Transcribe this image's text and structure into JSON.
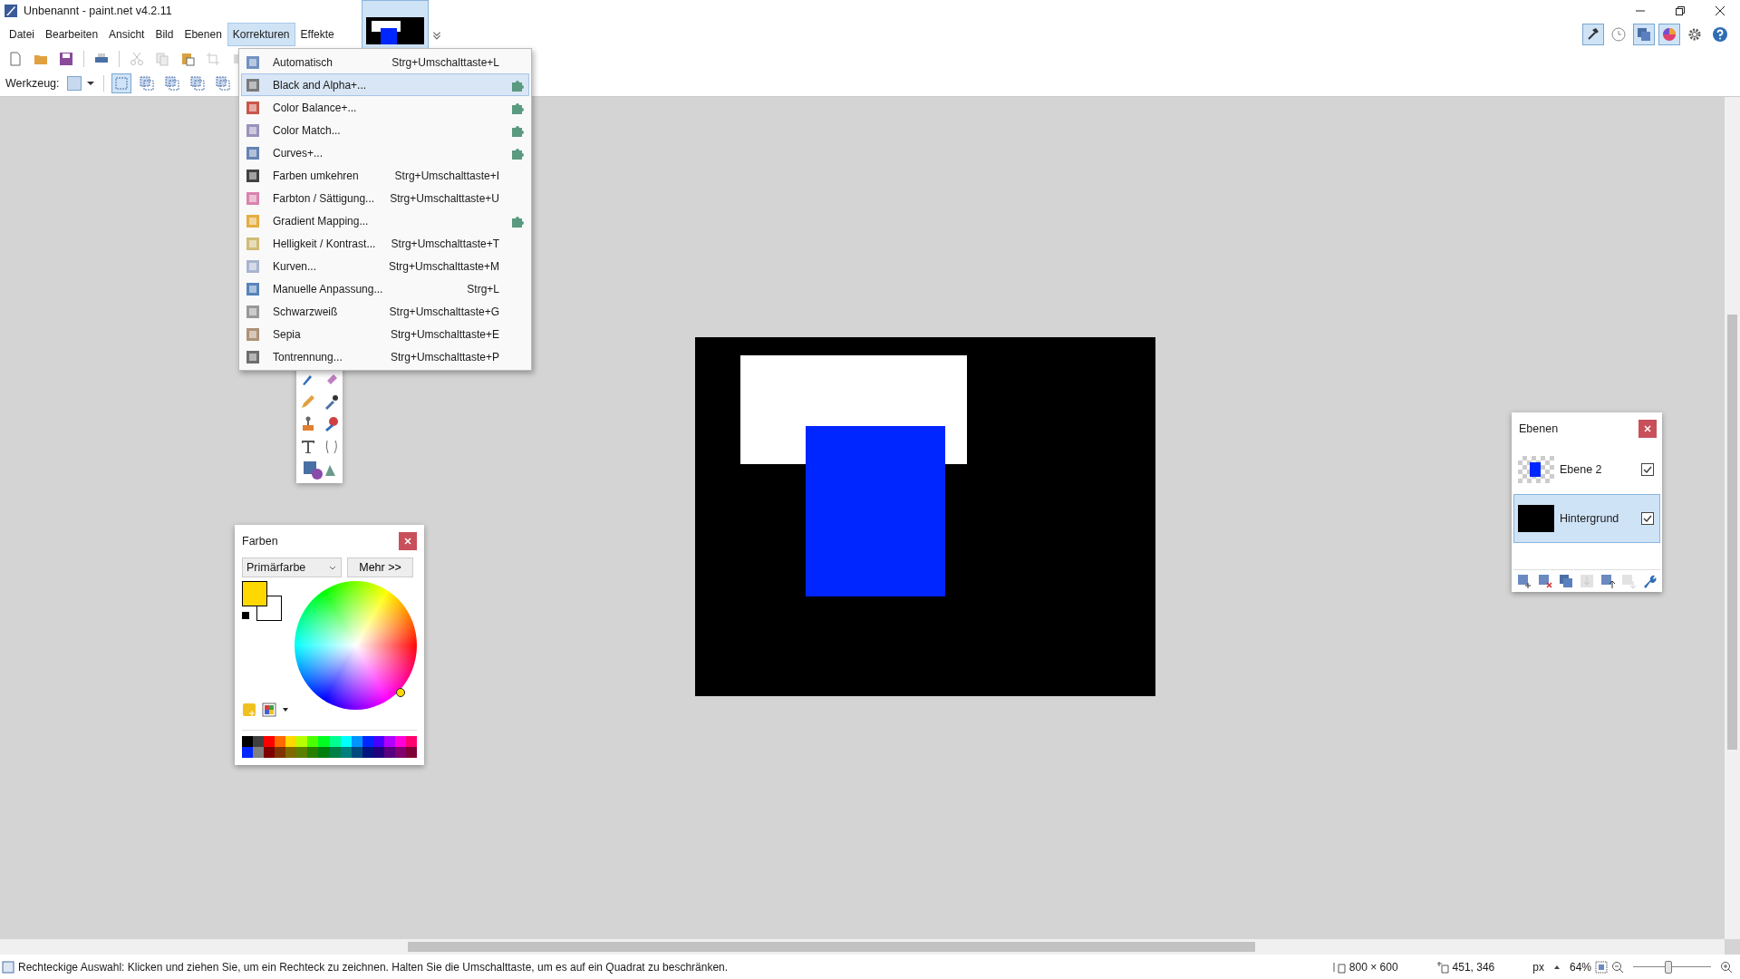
{
  "window": {
    "title": "Unbenannt - paint.net v4.2.11"
  },
  "menubar": [
    {
      "label": "Datei",
      "selected": false
    },
    {
      "label": "Bearbeiten",
      "selected": false
    },
    {
      "label": "Ansicht",
      "selected": false
    },
    {
      "label": "Bild",
      "selected": false
    },
    {
      "label": "Ebenen",
      "selected": false
    },
    {
      "label": "Korrekturen",
      "selected": true
    },
    {
      "label": "Effekte",
      "selected": false
    }
  ],
  "toolbar": {
    "tool_label": "Werkzeug:"
  },
  "menu": [
    {
      "label": "Automatisch",
      "shortcut": "Strg+Umschalttaste+L",
      "plugin": false,
      "selected": false
    },
    {
      "label": "Black and Alpha+...",
      "plugin": true,
      "selected": true
    },
    {
      "label": "Color Balance+...",
      "plugin": true,
      "selected": false
    },
    {
      "label": "Color Match...",
      "plugin": true,
      "selected": false
    },
    {
      "label": "Curves+...",
      "plugin": true,
      "selected": false
    },
    {
      "label": "Farben umkehren",
      "shortcut": "Strg+Umschalttaste+I",
      "plugin": false,
      "selected": false
    },
    {
      "label": "Farbton / Sättigung...",
      "shortcut": "Strg+Umschalttaste+U",
      "plugin": false,
      "selected": false
    },
    {
      "label": "Gradient Mapping...",
      "plugin": true,
      "selected": false
    },
    {
      "label": "Helligkeit / Kontrast...",
      "shortcut": "Strg+Umschalttaste+T",
      "plugin": false,
      "selected": false
    },
    {
      "label": "Kurven...",
      "shortcut": "Strg+Umschalttaste+M",
      "plugin": false,
      "selected": false
    },
    {
      "label": "Manuelle Anpassung...",
      "shortcut": "Strg+L",
      "plugin": false,
      "selected": false
    },
    {
      "label": "Schwarzweiß",
      "shortcut": "Strg+Umschalttaste+G",
      "plugin": false,
      "selected": false
    },
    {
      "label": "Sepia",
      "shortcut": "Strg+Umschalttaste+E",
      "plugin": false,
      "selected": false
    },
    {
      "label": "Tontrennung...",
      "shortcut": "Strg+Umschalttaste+P",
      "plugin": false,
      "selected": false
    }
  ],
  "colors_panel": {
    "title": "Farben",
    "mode": "Primärfarbe",
    "more_button": "Mehr >>",
    "palette": [
      {
        "color": "#000000"
      },
      {
        "color": "#404040"
      },
      {
        "color": "#ff0000"
      },
      {
        "color": "#ff6a00"
      },
      {
        "color": "#ffd800"
      },
      {
        "color": "#b6ff00"
      },
      {
        "color": "#4cff00"
      },
      {
        "color": "#00ff21"
      },
      {
        "color": "#00ff90"
      },
      {
        "color": "#00ffff"
      },
      {
        "color": "#0094ff"
      },
      {
        "color": "#0026ff"
      },
      {
        "color": "#4800ff"
      },
      {
        "color": "#b200ff"
      },
      {
        "color": "#ff00dc"
      },
      {
        "color": "#ff006e"
      },
      {
        "color": "#0026ff"
      },
      {
        "color": "#808080"
      },
      {
        "color": "#7f0000"
      },
      {
        "color": "#7f3300"
      },
      {
        "color": "#7f6a00"
      },
      {
        "color": "#5b7f00"
      },
      {
        "color": "#267f00"
      },
      {
        "color": "#007f0e"
      },
      {
        "color": "#007f46"
      },
      {
        "color": "#007f7f"
      },
      {
        "color": "#004a7f"
      },
      {
        "color": "#00137f"
      },
      {
        "color": "#21007f"
      },
      {
        "color": "#57007f"
      },
      {
        "color": "#7f006e"
      },
      {
        "color": "#7f0037"
      }
    ]
  },
  "layers_panel": {
    "title": "Ebenen",
    "layers": [
      {
        "name": "Ebene 2",
        "kind": "transparent",
        "visible": true,
        "selected": false
      },
      {
        "name": "Hintergrund",
        "kind": "solid",
        "visible": true,
        "selected": true
      }
    ]
  },
  "status_bar": {
    "hint": "Rechteckige Auswahl: Klicken und ziehen Sie, um ein Rechteck zu zeichnen. Halten Sie die Umschalttaste, um es auf ein Quadrat zu beschränken.",
    "image_size": "800 × 600",
    "cursor_position": "451, 346",
    "unit": "px",
    "zoom": "64%",
    "zoom_slider": {
      "level": 0.45
    }
  }
}
